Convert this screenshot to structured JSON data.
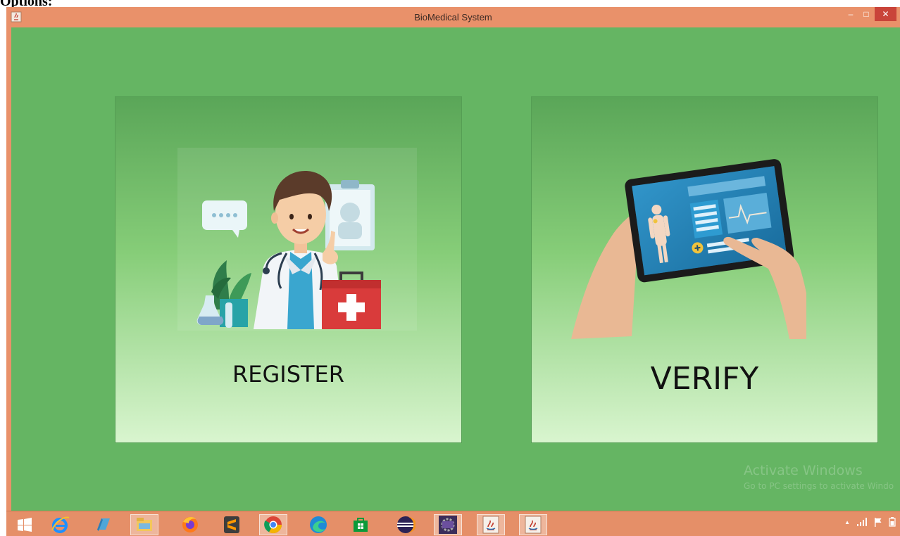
{
  "page_heading": "Options:",
  "window": {
    "title": "BioMedical System",
    "minimize_glyph": "–",
    "maximize_glyph": "□",
    "close_glyph": "✕"
  },
  "cards": {
    "register_label": "REGISTER",
    "verify_label": "VERIFY"
  },
  "watermark": {
    "line1": "Activate Windows",
    "line2": "Go to PC settings to activate Windo"
  },
  "taskbar": {
    "items": [
      "start-icon",
      "internet-explorer-icon",
      "windows-explorer-icon",
      "file-manager-icon",
      "firefox-icon",
      "sublime-text-icon",
      "chrome-icon",
      "edge-icon",
      "store-icon",
      "eclipse-icon",
      "java-ee-ide-icon",
      "java-app-icon",
      "java-app-icon"
    ],
    "tray_caret": "▲"
  },
  "colors": {
    "titlebar": "#e9916a",
    "client": "#65b563",
    "close_button": "#c9443a"
  }
}
